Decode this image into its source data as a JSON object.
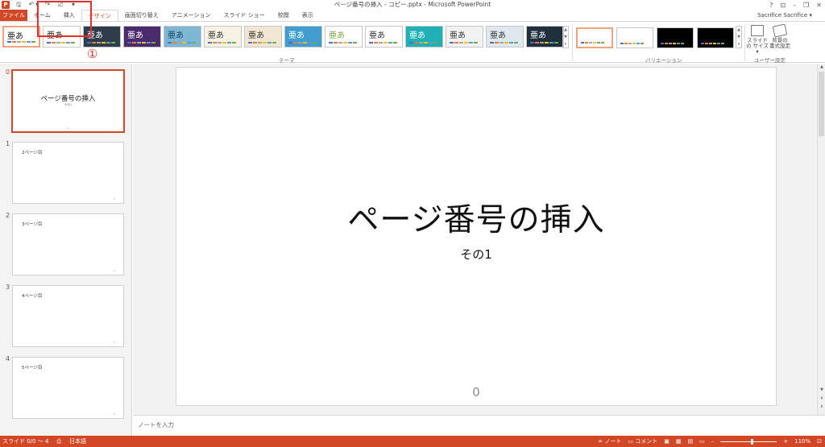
{
  "titlebar": {
    "title": "ページ番号の挿入 - コピー.pptx - Microsoft PowerPoint",
    "app_icon": "P",
    "help_icon": "?",
    "ribbon_display_icon": "⊡",
    "minimize_icon": "–",
    "restore_icon": "❐",
    "close_icon": "✕"
  },
  "qat": {
    "save": "🖫",
    "undo": "↶",
    "undo_drop": "▾",
    "redo": "↷",
    "present": "⎚",
    "more": "▾"
  },
  "tabs": [
    {
      "label": "ファイル"
    },
    {
      "label": "ホーム"
    },
    {
      "label": "挿入"
    },
    {
      "label": "デザイン"
    },
    {
      "label": "画面切り替え"
    },
    {
      "label": "アニメーション"
    },
    {
      "label": "スライド ショー"
    },
    {
      "label": "校閲"
    },
    {
      "label": "表示"
    }
  ],
  "user": {
    "name": "Sacrifice Sacrifice",
    "drop": "▾"
  },
  "ribbon": {
    "theme_sample": "亜あ",
    "themes_group_label": "テーマ",
    "variations_group_label": "バリエーション",
    "customize_group_label": "ユーザー設定",
    "slide_size_label": "スライドの サイズ ▾",
    "format_bg_label": "背景の 書式設定",
    "scroll_up": "▲",
    "scroll_down": "▼",
    "scroll_more": "▾"
  },
  "themes": [
    {
      "bg": "#ffffff",
      "fg": "#222222",
      "sel": true
    },
    {
      "bg": "#ffffff",
      "fg": "#222222"
    },
    {
      "bg": "#2f3d4a",
      "fg": "#ffffff"
    },
    {
      "bg": "#4b2a6e",
      "fg": "#ffffff"
    },
    {
      "bg": "#7db7d6",
      "fg": "#1a3c5a"
    },
    {
      "bg": "#f6f3e4",
      "fg": "#333333"
    },
    {
      "bg": "#f2e6d3",
      "fg": "#333333"
    },
    {
      "bg": "#3f9ecf",
      "fg": "#ffffff"
    },
    {
      "bg": "#ffffff",
      "fg": "#7aa93c"
    },
    {
      "bg": "#ffffff",
      "fg": "#333333"
    },
    {
      "bg": "#1fb1b6",
      "fg": "#ffffff"
    },
    {
      "bg": "#f2f2f2",
      "fg": "#333333"
    },
    {
      "bg": "#dfe8ef",
      "fg": "#333333"
    },
    {
      "bg": "#1f2f3e",
      "fg": "#ffffff"
    }
  ],
  "variants": [
    {
      "bg": "#ffffff",
      "sel": true
    },
    {
      "bg": "#ffffff"
    },
    {
      "bg": "#000000"
    },
    {
      "bg": "#000000"
    }
  ],
  "annotation": {
    "marker": "①"
  },
  "slides": [
    {
      "num": "0",
      "title": "ページ番号の挿入",
      "subtitle": "その1",
      "footer": "0",
      "sel": true
    },
    {
      "num": "1",
      "title": "2ページ目",
      "footer": "1"
    },
    {
      "num": "2",
      "title": "3ページ目",
      "footer": "2"
    },
    {
      "num": "3",
      "title": "4ページ目",
      "footer": "3"
    },
    {
      "num": "4",
      "title": "5ページ目",
      "footer": "4"
    }
  ],
  "main_slide": {
    "title": "ページ番号の挿入",
    "subtitle": "その1",
    "number": "0"
  },
  "notes": {
    "placeholder": "ノートを入力"
  },
  "scrollbar": {
    "up": "▲",
    "down": "▼",
    "prev": "⇞",
    "next": "⇟"
  },
  "status": {
    "slide_info": "スライド 0/0 ～ 4",
    "proofing_icon": "⎙",
    "language": "日本語",
    "notes_label": "≐ ノート",
    "comments_label": "▭ コメント",
    "view_normal": "▣",
    "view_sorter": "▦",
    "view_reading": "▤",
    "view_slideshow": "▭",
    "zoom_minus": "–",
    "zoom_plus": "+",
    "zoom_fit": "⊡",
    "zoom": "110%"
  },
  "colors": {
    "accent": "#d24726",
    "annotation": "#e03030"
  }
}
